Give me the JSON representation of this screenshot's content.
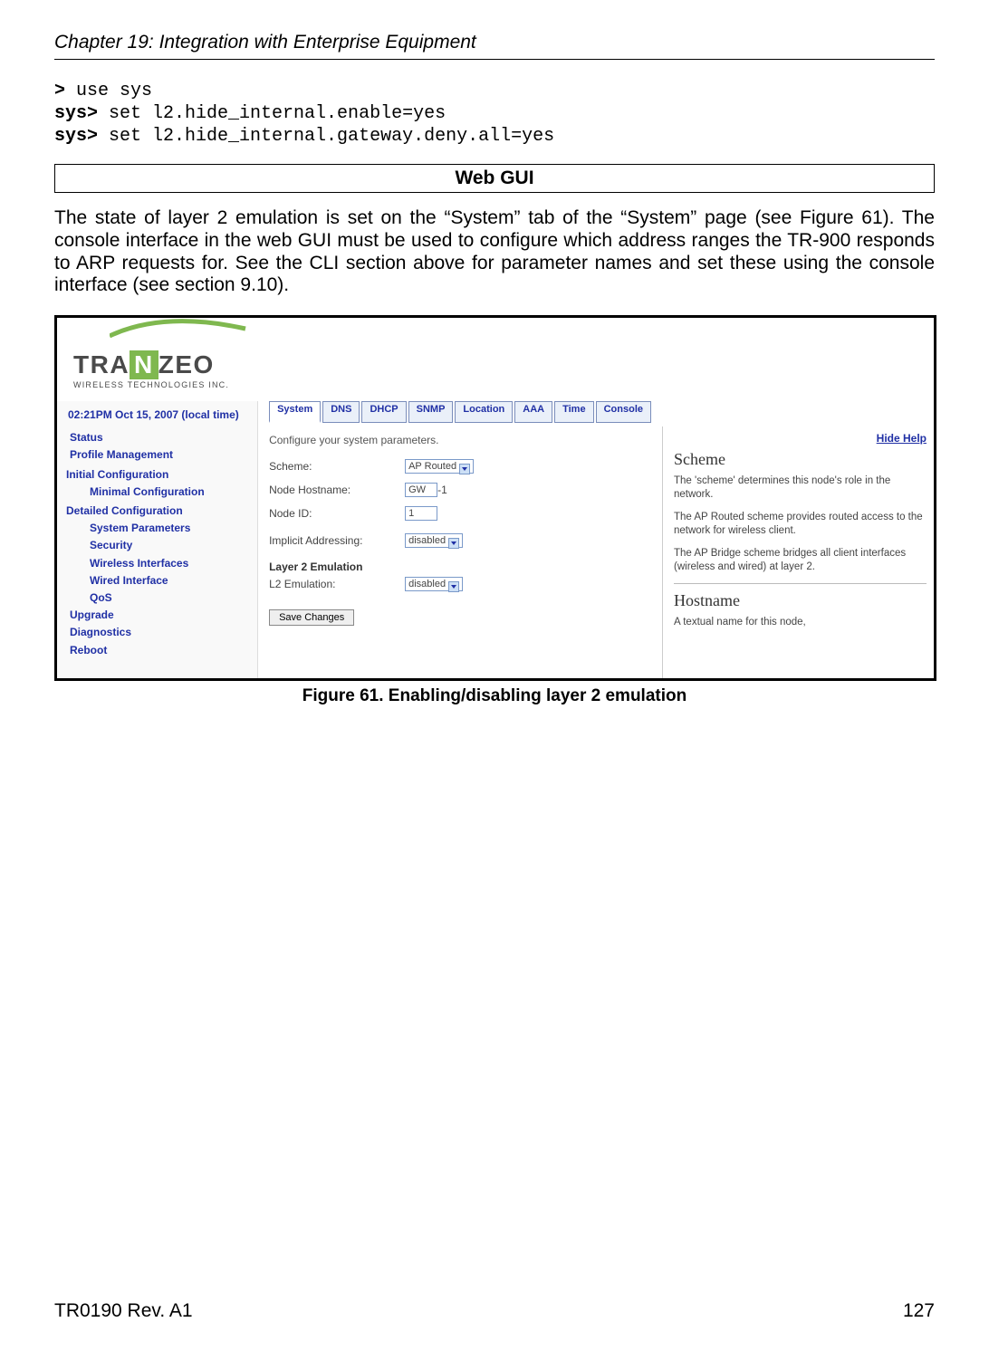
{
  "header": {
    "chapter": "Chapter 19: Integration with Enterprise Equipment"
  },
  "cli": {
    "l1_prompt": ">",
    "l1_cmd": " use sys",
    "l2_prompt": "sys>",
    "l2_cmd": " set l2.hide_internal.enable=yes",
    "l3_prompt": "sys>",
    "l3_cmd": " set l2.hide_internal.gateway.deny.all=yes"
  },
  "section_title": "Web GUI",
  "paragraph": "The state of layer 2 emulation is set on the “System” tab of the “System” page (see Figure 61). The console interface in the web GUI must be used to configure which address ranges the TR-900 responds to ARP requests for. See the CLI section above for parameter names and set these using the console interface (see section 9.10).",
  "screenshot": {
    "logo": {
      "brand_left": "TRA",
      "brand_n": "N",
      "brand_right": "ZEO",
      "sub": "WIRELESS TECHNOLOGIES INC."
    },
    "sidebar": {
      "clock": "02:21PM Oct 15, 2007 (local time)",
      "items": {
        "status": "Status",
        "profile": "Profile Management",
        "initial": "Initial Configuration",
        "minimal": "Minimal Configuration",
        "detailed": "Detailed Configuration",
        "sysparam": "System Parameters",
        "security": "Security",
        "wireless": "Wireless Interfaces",
        "wired": "Wired Interface",
        "qos": "QoS",
        "upgrade": "Upgrade",
        "diag": "Diagnostics",
        "reboot": "Reboot"
      }
    },
    "tabs": [
      "System",
      "DNS",
      "DHCP",
      "SNMP",
      "Location",
      "AAA",
      "Time",
      "Console"
    ],
    "config": {
      "intro": "Configure your system parameters.",
      "scheme_lbl": "Scheme:",
      "scheme_val": "AP Routed",
      "host_lbl": "Node Hostname:",
      "host_val": "GW",
      "host_suffix": "-1",
      "id_lbl": "Node ID:",
      "id_val": "1",
      "implicit_lbl": "Implicit Addressing:",
      "implicit_val": "disabled",
      "l2_header": "Layer 2 Emulation",
      "l2_lbl": "L2 Emulation:",
      "l2_val": "disabled",
      "save_btn": "Save Changes"
    },
    "help": {
      "hide": "Hide Help",
      "h1": "Scheme",
      "p1": "The 'scheme' determines this node's role in the network.",
      "p2": "The AP Routed scheme provides routed access to the network for wireless client.",
      "p3": "The AP Bridge scheme bridges all client interfaces (wireless and wired) at layer 2.",
      "h2": "Hostname",
      "p4": "A textual name for this node,"
    }
  },
  "caption": "Figure 61. Enabling/disabling layer 2 emulation",
  "footer": {
    "left": "TR0190 Rev. A1",
    "right": "127"
  }
}
